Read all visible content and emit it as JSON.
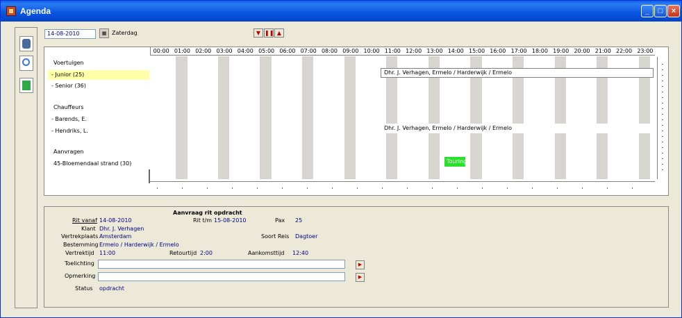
{
  "window": {
    "title": "Agenda"
  },
  "toolbar": {
    "date": "14-08-2010",
    "day": "Zaterdag"
  },
  "gantt": {
    "hours": [
      "00:00",
      "01:00",
      "02:00",
      "03:00",
      "04:00",
      "05:00",
      "06:00",
      "07:00",
      "08:00",
      "09:00",
      "10:00",
      "11:00",
      "12:00",
      "13:00",
      "14:00",
      "15:00",
      "16:00",
      "17:00",
      "18:00",
      "19:00",
      "20:00",
      "21:00",
      "22:00",
      "23:00"
    ],
    "rows": {
      "voertuigen": "Voertuigen",
      "junior": " - Junior (25)",
      "senior": " - Senior (36)",
      "chauffeurs": "Chauffeurs",
      "barends": " - Barends, E.",
      "hendriks": " - Hendriks, L.",
      "aanvragen": "Aanvragen",
      "bloemendaal": "45-Bloemendaal strand (30)"
    },
    "bars": {
      "junior": "Dhr. J. Verhagen, Ermelo / Harderwijk / Ermelo",
      "hendriks": "Dhr. J. Verhagen, Ermelo / Harderwijk / Ermelo",
      "aanvraag": "Touring"
    },
    "colors": {
      "band": "#d8d5d0",
      "selected_row": "#ffffaa",
      "aanvraag_bar": "#2be02b"
    }
  },
  "detail": {
    "title": "Aanvraag rit opdracht",
    "labels": {
      "rit_vanaf": "Rit vanaf",
      "rit_tm": "Rit t/m",
      "pax": "Pax",
      "klant": "Klant",
      "vertrekplaats": "Vertrekplaats",
      "soort_reis": "Soort Reis",
      "bestemming": "Bestemming",
      "vertrektijd": "Vertrektijd",
      "retourtijd": "Retourtijd",
      "aankomsttijd": "Aankomsttijd",
      "toelichting": "Toelichting",
      "opmerking": "Opmerking",
      "status": "Status"
    },
    "values": {
      "rit_vanaf": "14-08-2010",
      "rit_tm": "15-08-2010",
      "pax": "25",
      "klant": "Dhr. J. Verhagen",
      "vertrekplaats": "Amsterdam",
      "soort_reis": "Dagtoer",
      "bestemming": "Ermelo / Harderwijk / Ermelo",
      "vertrektijd": "11:00",
      "retourtijd": "2:00",
      "aankomsttijd": "12:40",
      "toelichting": "",
      "opmerking": "",
      "status": "opdracht"
    }
  }
}
